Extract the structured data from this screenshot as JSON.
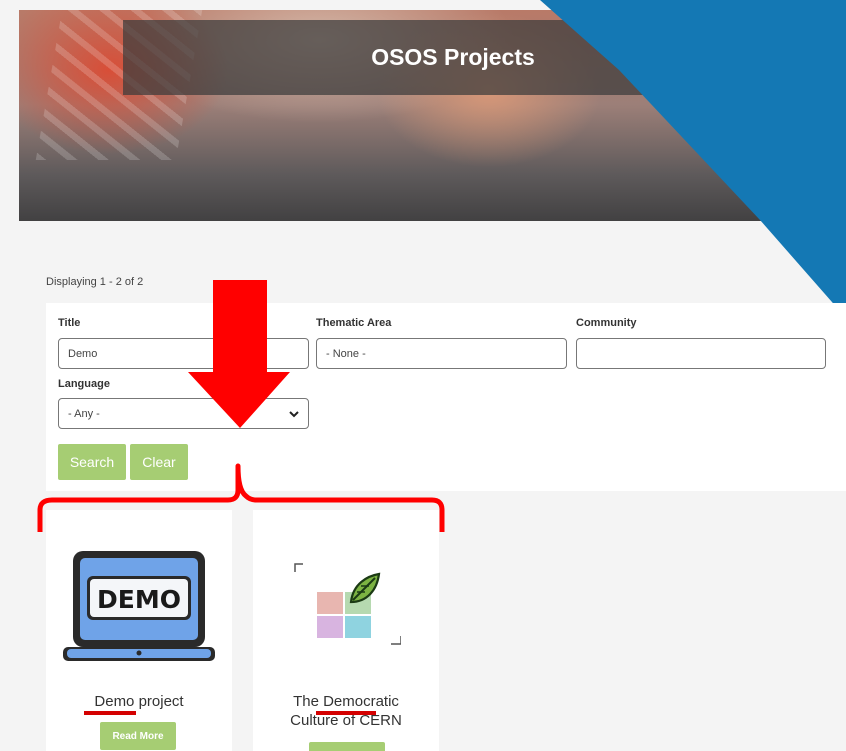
{
  "header": {
    "title": "OSOS Projects"
  },
  "results": {
    "display_count": "Displaying 1 - 2 of 2"
  },
  "filters": {
    "title_label": "Title",
    "title_value": "Demo",
    "thematic_label": "Thematic Area",
    "thematic_value": "- None -",
    "community_label": "Community",
    "community_value": "",
    "language_label": "Language",
    "language_value": "- Any -",
    "search_label": "Search",
    "clear_label": "Clear"
  },
  "cards": [
    {
      "title": "Demo project",
      "logo_text": "DEMO",
      "button": "Read More"
    },
    {
      "title_line1": "The Democratic",
      "title_line2": "Culture of CERN",
      "button": ""
    }
  ],
  "colors": {
    "accent_green": "#a6cd73",
    "blue_banner": "#1478b4",
    "annotation_red": "#ff0000",
    "laptop_blue": "#6fa3e8"
  }
}
